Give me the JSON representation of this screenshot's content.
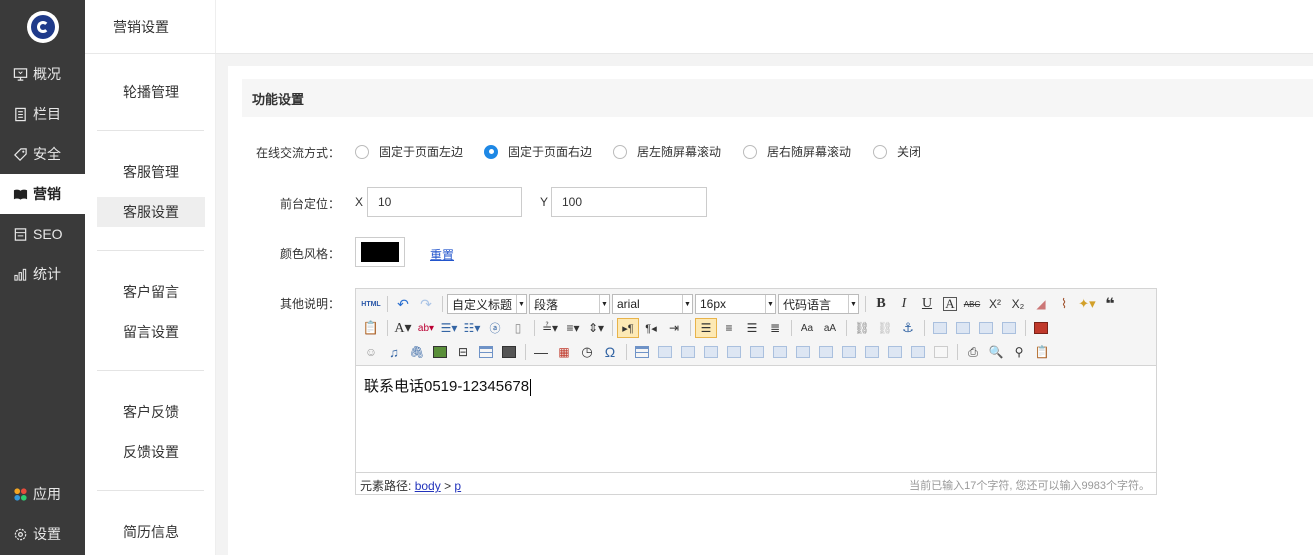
{
  "sidebar": {
    "items": [
      {
        "label": "概况",
        "icon": "monitor-icon"
      },
      {
        "label": "栏目",
        "icon": "document-icon"
      },
      {
        "label": "安全",
        "icon": "tag-icon"
      },
      {
        "label": "营销",
        "icon": "book-icon",
        "active": true
      },
      {
        "label": "SEO",
        "icon": "storefront-icon"
      },
      {
        "label": "统计",
        "icon": "bar-chart-icon"
      }
    ],
    "bottom": [
      {
        "label": "应用",
        "icon": "apps-icon"
      },
      {
        "label": "设置",
        "icon": "gear-icon"
      }
    ]
  },
  "subnav": {
    "title": "营销设置",
    "items": [
      {
        "label": "轮播管理"
      },
      {
        "label": "客服管理"
      },
      {
        "label": "客服设置",
        "active": true
      },
      {
        "label": "客户留言"
      },
      {
        "label": "留言设置"
      },
      {
        "label": "客户反馈"
      },
      {
        "label": "反馈设置"
      },
      {
        "label": "简历信息"
      }
    ]
  },
  "panel": {
    "title": "功能设置"
  },
  "form": {
    "mode_label": "在线交流方式：",
    "mode_options": [
      {
        "label": "固定于页面左边",
        "checked": false
      },
      {
        "label": "固定于页面右边",
        "checked": true
      },
      {
        "label": "居左随屏幕滚动",
        "checked": false
      },
      {
        "label": "居右随屏幕滚动",
        "checked": false
      },
      {
        "label": "关闭",
        "checked": false
      }
    ],
    "position_label": "前台定位：",
    "x_label": "X",
    "x_value": "10",
    "y_label": "Y",
    "y_value": "100",
    "color_label": "颜色风格：",
    "color_value": "#000000",
    "reset_label": "重置",
    "notes_label": "其他说明："
  },
  "editor": {
    "selects": {
      "heading": "自定义标题",
      "paragraph": "段落",
      "font": "arial",
      "size": "16px",
      "code": "代码语言"
    },
    "html_button": "HTML",
    "content": "联系电话0519-12345678",
    "path_label": "元素路径:",
    "path_body": "body",
    "path_sep": ">",
    "path_p": "p",
    "counter": "当前已输入17个字符, 您还可以输入9983个字符。"
  },
  "colors": {
    "sidebar_bg": "#3a3a3a",
    "accent": "#1e88e5",
    "link": "#2255cc"
  }
}
